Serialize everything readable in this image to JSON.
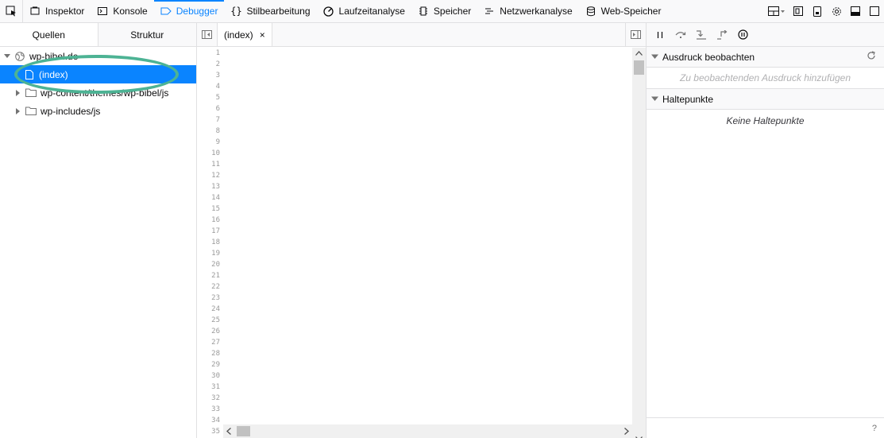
{
  "toolbar": {
    "tabs": [
      {
        "label": "Inspektor",
        "icon": "inspector-icon"
      },
      {
        "label": "Konsole",
        "icon": "console-icon"
      },
      {
        "label": "Debugger",
        "icon": "debugger-icon"
      },
      {
        "label": "Stilbearbeitung",
        "icon": "braces-icon"
      },
      {
        "label": "Laufzeitanalyse",
        "icon": "performance-icon"
      },
      {
        "label": "Speicher",
        "icon": "memory-icon"
      },
      {
        "label": "Netzwerkanalyse",
        "icon": "network-icon"
      },
      {
        "label": "Web-Speicher",
        "icon": "storage-icon"
      }
    ],
    "selected_tab": "Debugger"
  },
  "sources_panel": {
    "tabs": [
      "Quellen",
      "Struktur"
    ],
    "tree": [
      {
        "label": "wp-bibel.de",
        "icon": "globe-icon",
        "expanded": true
      },
      {
        "label": "(index)",
        "icon": "file-icon",
        "selected": true
      },
      {
        "label": "wp-content/themes/wp-bibel/js",
        "icon": "folder-icon"
      },
      {
        "label": "wp-includes/js",
        "icon": "folder-icon"
      }
    ]
  },
  "editor": {
    "open_tab": "(index)",
    "close_glyph": "×",
    "line_numbers": [
      "1",
      "2",
      "3",
      "4",
      "5",
      "6",
      "7",
      "8",
      "9",
      "10",
      "11",
      "12",
      "13",
      "14",
      "15",
      "16",
      "17",
      "18",
      "19",
      "20",
      "21",
      "22",
      "23",
      "24",
      "25",
      "26",
      "27",
      "28",
      "29",
      "30",
      "31",
      "32",
      "33",
      "34",
      "35"
    ]
  },
  "right_panel": {
    "watch": {
      "title": "Ausdruck beobachten",
      "placeholder": "Zu beobachtenden Ausdruck hinzufügen"
    },
    "breakpoints": {
      "title": "Haltepunkte",
      "empty": "Keine Haltepunkte"
    },
    "help": "?"
  },
  "colors": {
    "accent": "#0a84ff",
    "highlight_ring": "#4db394",
    "toolbar_bg": "#f9f9fa"
  }
}
